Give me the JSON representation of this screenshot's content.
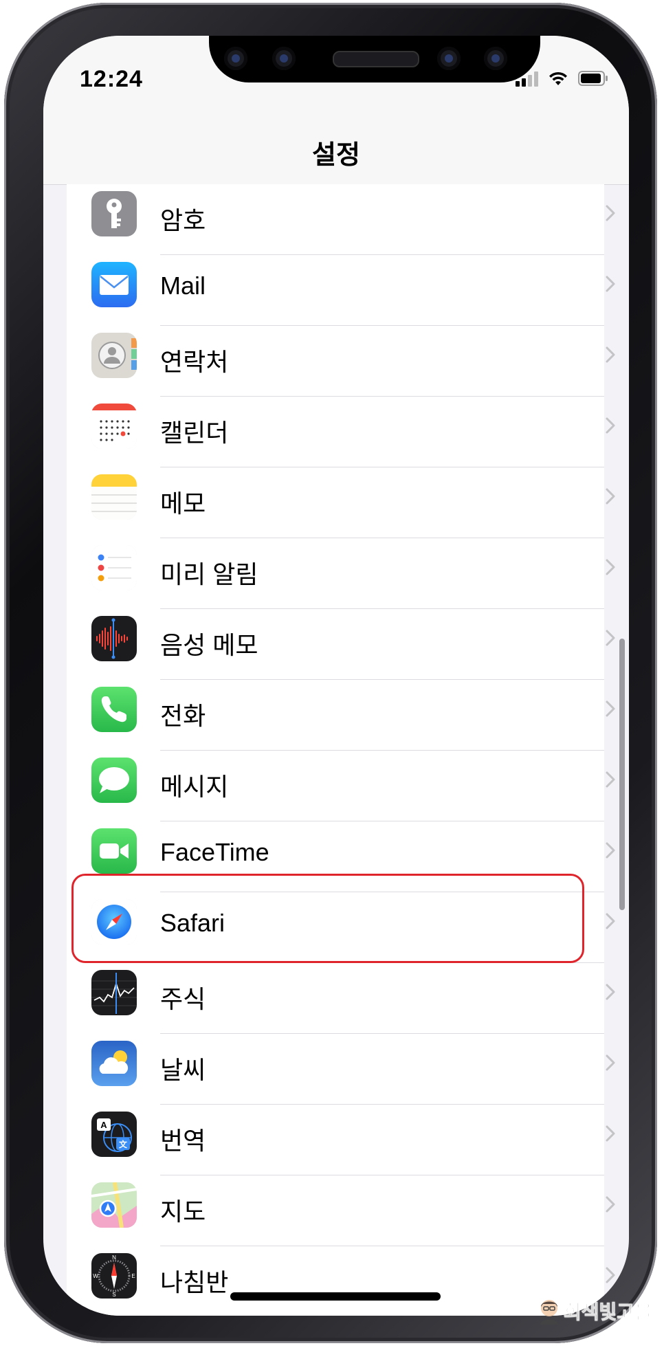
{
  "status": {
    "time": "12:24"
  },
  "nav": {
    "title": "설정"
  },
  "rows": [
    {
      "label": "암호",
      "icon": "key-icon",
      "color": "#8e8e93"
    },
    {
      "label": "Mail",
      "icon": "mail-icon",
      "color": "#3a8ef6"
    },
    {
      "label": "연락처",
      "icon": "contacts-icon",
      "color": "#d8d6cf"
    },
    {
      "label": "캘린더",
      "icon": "calendar-icon",
      "color": "#ffffff"
    },
    {
      "label": "메모",
      "icon": "notes-icon",
      "color": "#ffd23a"
    },
    {
      "label": "미리 알림",
      "icon": "reminders-icon",
      "color": "#ffffff"
    },
    {
      "label": "음성 메모",
      "icon": "voice-memos-icon",
      "color": "#1c1c1e"
    },
    {
      "label": "전화",
      "icon": "phone-icon",
      "color": "#34c759"
    },
    {
      "label": "메시지",
      "icon": "messages-icon",
      "color": "#34c759"
    },
    {
      "label": "FaceTime",
      "icon": "facetime-icon",
      "color": "#34c759"
    },
    {
      "label": "Safari",
      "icon": "safari-icon",
      "color": "#1a8cff"
    },
    {
      "label": "주식",
      "icon": "stocks-icon",
      "color": "#1c1c1e"
    },
    {
      "label": "날씨",
      "icon": "weather-icon",
      "color": "#3b7fd6"
    },
    {
      "label": "번역",
      "icon": "translate-icon",
      "color": "#1c1c1e"
    },
    {
      "label": "지도",
      "icon": "maps-icon",
      "color": "#7ccf7a"
    },
    {
      "label": "나침반",
      "icon": "compass-icon",
      "color": "#1c1c1e"
    }
  ],
  "highlight": {
    "target": "Safari",
    "color": "#e0242c"
  },
  "watermark": {
    "text": "회색빛고을"
  }
}
